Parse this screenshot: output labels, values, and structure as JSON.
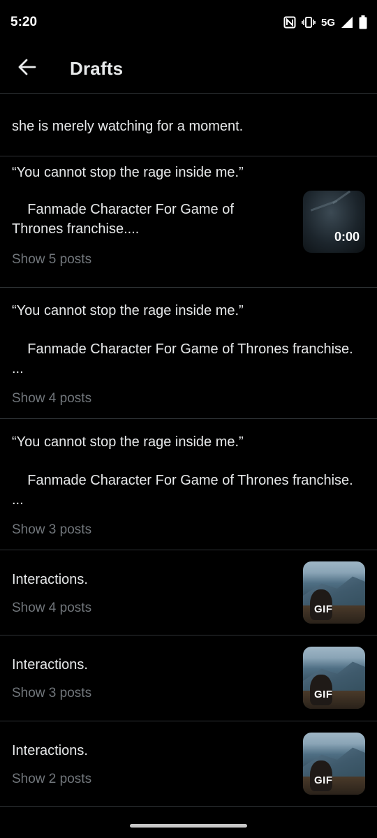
{
  "status": {
    "time": "5:20",
    "network": "5G",
    "icons": [
      "nfc-icon",
      "vibrate-icon",
      "signal-icon",
      "battery-icon"
    ]
  },
  "header": {
    "back_icon": "arrow-left-icon",
    "title": "Drafts"
  },
  "drafts": [
    {
      "text": "she is merely watching for a moment."
    },
    {
      "text": "“You cannot stop the rage inside me.”",
      "text2": "    Fanmade Character For Game of\nThrones franchise....",
      "sub": "Show 5 posts",
      "thumb": "video",
      "duration": "0:00"
    },
    {
      "text": "“You cannot stop the rage inside me.”",
      "text2": "    Fanmade Character For Game of Thrones franchise.\n...",
      "sub": "Show 4 posts"
    },
    {
      "text": "“You cannot stop the rage inside me.”",
      "text2": "    Fanmade Character For Game of Thrones franchise.\n...",
      "sub": "Show 3 posts"
    },
    {
      "text": "Interactions.",
      "sub": "Show 4 posts",
      "thumb": "gif",
      "badge": "GIF"
    },
    {
      "text": "Interactions.",
      "sub": "Show 3 posts",
      "thumb": "gif",
      "badge": "GIF"
    },
    {
      "text": "Interactions.",
      "sub": "Show 2 posts",
      "thumb": "gif",
      "badge": "GIF"
    }
  ],
  "colors": {
    "background": "#000000",
    "text": "#e7e9ea",
    "secondary_text": "#71767b",
    "divider": "#2f3336"
  }
}
